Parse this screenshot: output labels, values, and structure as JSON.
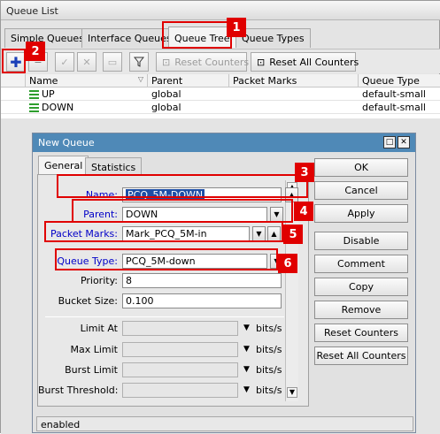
{
  "window": {
    "title": "Queue List"
  },
  "tabs": [
    "Simple Queues",
    "Interface Queues",
    "Queue Tree",
    "Queue Types"
  ],
  "toolbar": {
    "reset_counters": "Reset Counters",
    "reset_all_counters": "Reset All Counters"
  },
  "table": {
    "headers": [
      "Name",
      "Parent",
      "Packet Marks",
      "Queue Type"
    ],
    "rows": [
      {
        "name": "UP",
        "parent": "global",
        "packet_marks": "",
        "queue_type": "default-small"
      },
      {
        "name": "DOWN",
        "parent": "global",
        "packet_marks": "",
        "queue_type": "default-small"
      }
    ]
  },
  "dialog": {
    "title": "New Queue",
    "tabs": [
      "General",
      "Statistics"
    ],
    "fields": {
      "name_label": "Name:",
      "name_value": "PCQ_5M-DOWN",
      "parent_label": "Parent:",
      "parent_value": "DOWN",
      "packet_marks_label": "Packet Marks:",
      "packet_marks_value": "Mark_PCQ_5M-in",
      "queue_type_label": "Queue Type:",
      "queue_type_value": "PCQ_5M-down",
      "priority_label": "Priority:",
      "priority_value": "8",
      "bucket_size_label": "Bucket Size:",
      "bucket_size_value": "0.100",
      "limit_at_label": "Limit At",
      "max_limit_label": "Max Limit",
      "burst_limit_label": "Burst Limit",
      "burst_threshold_label": "Burst Threshold:",
      "unit": "bits/s"
    },
    "buttons": [
      "OK",
      "Cancel",
      "Apply",
      "Disable",
      "Comment",
      "Copy",
      "Remove",
      "Reset Counters",
      "Reset All Counters"
    ],
    "status": "enabled"
  },
  "annotations": [
    "1",
    "2",
    "3",
    "4",
    "5",
    "6"
  ],
  "colors": {
    "highlight": "#e00000",
    "dialog_title": "#4f89b7",
    "label_blue": "#0000c8"
  }
}
